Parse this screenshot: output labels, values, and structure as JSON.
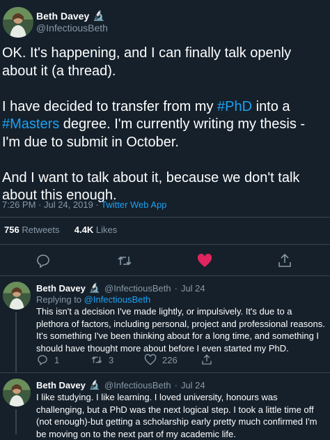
{
  "main": {
    "display_name": "Beth Davey",
    "name_emoji": "🔬",
    "handle": "@InfectiousBeth",
    "paragraph_1": "OK. It's happening, and I can finally talk openly about it (a thread).",
    "paragraph_2_line_1_pre": "I have decided to transfer from my ",
    "hashtag_phd": "#PhD",
    "paragraph_2_line_1_post": " into a",
    "hashtag_masters": "#Masters",
    "paragraph_2_rest": " degree. I'm currently writing my thesis - I'm due to submit in October.",
    "paragraph_3": "And I want to talk about it, because we don't talk about this enough.",
    "timestamp": "7:26 PM · Jul 24, 2019 · ",
    "source": "Twitter Web App",
    "retweet_count": "756",
    "retweet_label": "Retweets",
    "like_count": "4.4K",
    "like_label": "Likes"
  },
  "colors": {
    "background": "#15202b",
    "link_blue": "#1da1f2",
    "secondary_text": "#8899a6",
    "divider": "#38444d",
    "like_red": "#e0245e"
  },
  "replies": [
    {
      "display_name": "Beth Davey",
      "name_emoji": "🔬",
      "handle": "@InfectiousBeth",
      "date": "Jul 24",
      "replying_prefix": "Replying to ",
      "replying_handle": "@InfectiousBeth",
      "text": "This isn't a decision I've made lightly, or impulsively. It's due to a plethora of factors, including personal, project and professional reasons. It's something I've been thinking about for a long time, and something I should have thought more about before I even started my PhD.",
      "reply_count": "1",
      "retweet_count": "3",
      "like_count": "226"
    },
    {
      "display_name": "Beth Davey",
      "name_emoji": "🔬",
      "handle": "@InfectiousBeth",
      "date": "Jul 24",
      "text": "I like studying. I like learning. I loved university, honours was challenging, but a PhD was the next logical step. I took a little time off (not enough)-but getting a scholarship early pretty much confirmed I'm be moving on to the next part of my academic life."
    }
  ]
}
